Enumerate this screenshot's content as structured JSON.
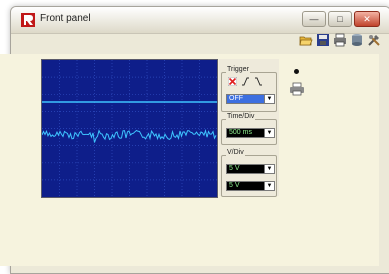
{
  "window": {
    "title": "Front panel"
  },
  "toolbar": {
    "icons": [
      "folder-open-icon",
      "save-icon",
      "print-icon",
      "database-icon",
      "tools-icon"
    ]
  },
  "trigger": {
    "label": "Trigger",
    "mode": "OFF"
  },
  "time_div": {
    "label": "Time/Div",
    "value": "500 ms"
  },
  "v_div": {
    "label": "V/Div",
    "ch1": "5 V",
    "ch2": "5 V"
  },
  "colors": {
    "scope_bg": "#0e1e8a",
    "grid": "#2f4cc0",
    "trace": "#3ec4ff",
    "readout": "#8ff08f"
  }
}
